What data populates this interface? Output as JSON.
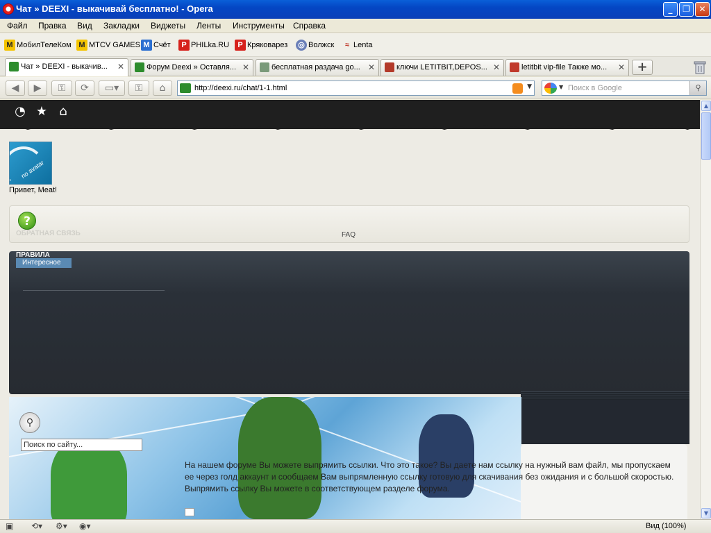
{
  "window": {
    "title": "Чат » DEEXI - выкачивай бесплатно! - Opera"
  },
  "menu": [
    "Файл",
    "Правка",
    "Вид",
    "Закладки",
    "Виджеты",
    "Ленты",
    "Инструменты",
    "Справка"
  ],
  "bookmarks": [
    {
      "label": "МобилТелеКом",
      "icon": "m-yellow-icon",
      "color": "#f4c400"
    },
    {
      "label": "MTCV GAMES",
      "icon": "m-yellow-icon",
      "color": "#f4c400"
    },
    {
      "label": "Счёт",
      "icon": "m-blue-icon",
      "color": "#2b6fd1"
    },
    {
      "label": "PHILka.RU",
      "icon": "red-page-icon",
      "color": "#d6221c"
    },
    {
      "label": "Кряковарез",
      "icon": "red-page-icon",
      "color": "#d6221c"
    },
    {
      "label": "Волжск",
      "icon": "globe-icon",
      "color": "#6a7fb8"
    },
    {
      "label": "Lenta",
      "icon": "lenta-icon",
      "color": "#c0392b"
    }
  ],
  "tabs": [
    {
      "label": "Чат » DEEXI - выкачив...",
      "active": true
    },
    {
      "label": "Форум Deexi » Оставля..."
    },
    {
      "label": "бесплатная раздача go..."
    },
    {
      "label": "ключи LETITBIT,DEPOS..."
    },
    {
      "label": "letitbit vip-file Также мо..."
    }
  ],
  "address": {
    "url": "http://deexi.ru/chat/1-1.html"
  },
  "search": {
    "placeholder": "Поиск в Google"
  },
  "page": {
    "greeting": "Привет, Meat!",
    "avatar_text": "no avatar",
    "feedback": "ОБРАТНАЯ СВЯЗЬ",
    "faq": "FAQ",
    "rules": "ПРАВИЛА",
    "interesting": "Интересное",
    "site_search_value": "Поиск по сайту...",
    "forum_text": "На нашем форуме Вы можете выпрямить ссылки. Что это такое? Вы даете нам ссылку на нужный вам файл, мы пропускаем ее через голд аккаунт и сообщаем Вам выпрямленную ссылку готовую для скачивания без ожидания и с большой скоростью. Выпрямить ссылку Вы можете в соответствующем разделе форума."
  },
  "status": {
    "zoom": "Вид (100%)"
  }
}
